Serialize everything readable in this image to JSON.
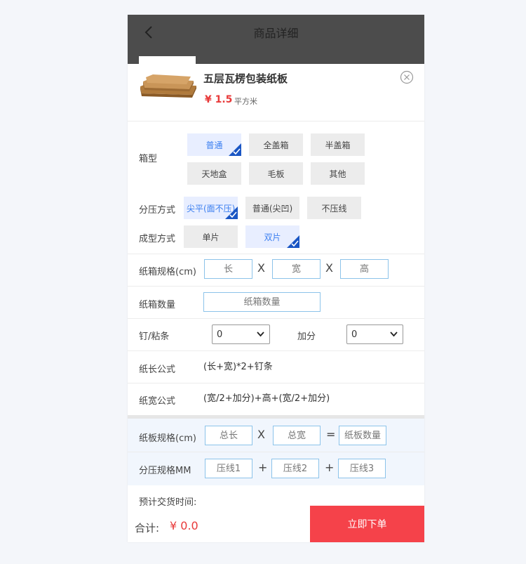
{
  "header": {
    "title": "商品详细"
  },
  "product": {
    "name": "五层瓦楞包装纸板",
    "price": "¥ 1.5",
    "unit": "平方米"
  },
  "box_type": {
    "label": "箱型",
    "options": [
      "普通",
      "全盖箱",
      "半盖箱",
      "天地盒",
      "毛板",
      "其他"
    ],
    "selected": "普通"
  },
  "press_method": {
    "label": "分压方式",
    "options": [
      "尖平(面不压)",
      "普通(尖凹)",
      "不压线"
    ],
    "selected": "尖平(面不压)"
  },
  "forming": {
    "label": "成型方式",
    "options": [
      "单片",
      "双片"
    ],
    "selected": "双片"
  },
  "box_spec": {
    "label": "纸箱规格(cm)",
    "length_placeholder": "长",
    "width_placeholder": "宽",
    "height_placeholder": "高",
    "sep": "X"
  },
  "box_qty": {
    "label": "纸箱数量",
    "placeholder": "纸箱数量"
  },
  "nail": {
    "label": "钉/粘条",
    "value": "0",
    "add_label": "加分",
    "add_value": "0"
  },
  "length_formula": {
    "label": "纸长公式",
    "value": "(长+宽)*2+钉条"
  },
  "width_formula": {
    "label": "纸宽公式",
    "value": "(宽/2+加分)+高+(宽/2+加分)"
  },
  "board_spec": {
    "label": "纸板规格(cm)",
    "total_length_placeholder": "总长",
    "total_width_placeholder": "总宽",
    "count_placeholder": "纸板数量",
    "times": "X",
    "equals": "="
  },
  "press_spec": {
    "label": "分压规格MM",
    "line1_placeholder": "压线1",
    "line2_placeholder": "压线2",
    "line3_placeholder": "压线3",
    "plus": "+"
  },
  "delivery": {
    "label": "预计交货时间:"
  },
  "footer": {
    "total_label": "合计:",
    "total_value": "¥ 0.0",
    "order_button": "立即下单"
  },
  "colors": {
    "accent_blue": "#1a56c4",
    "price_red": "#e83a3a",
    "order_red": "#f5424a",
    "header_bg": "#4c4c4c"
  }
}
